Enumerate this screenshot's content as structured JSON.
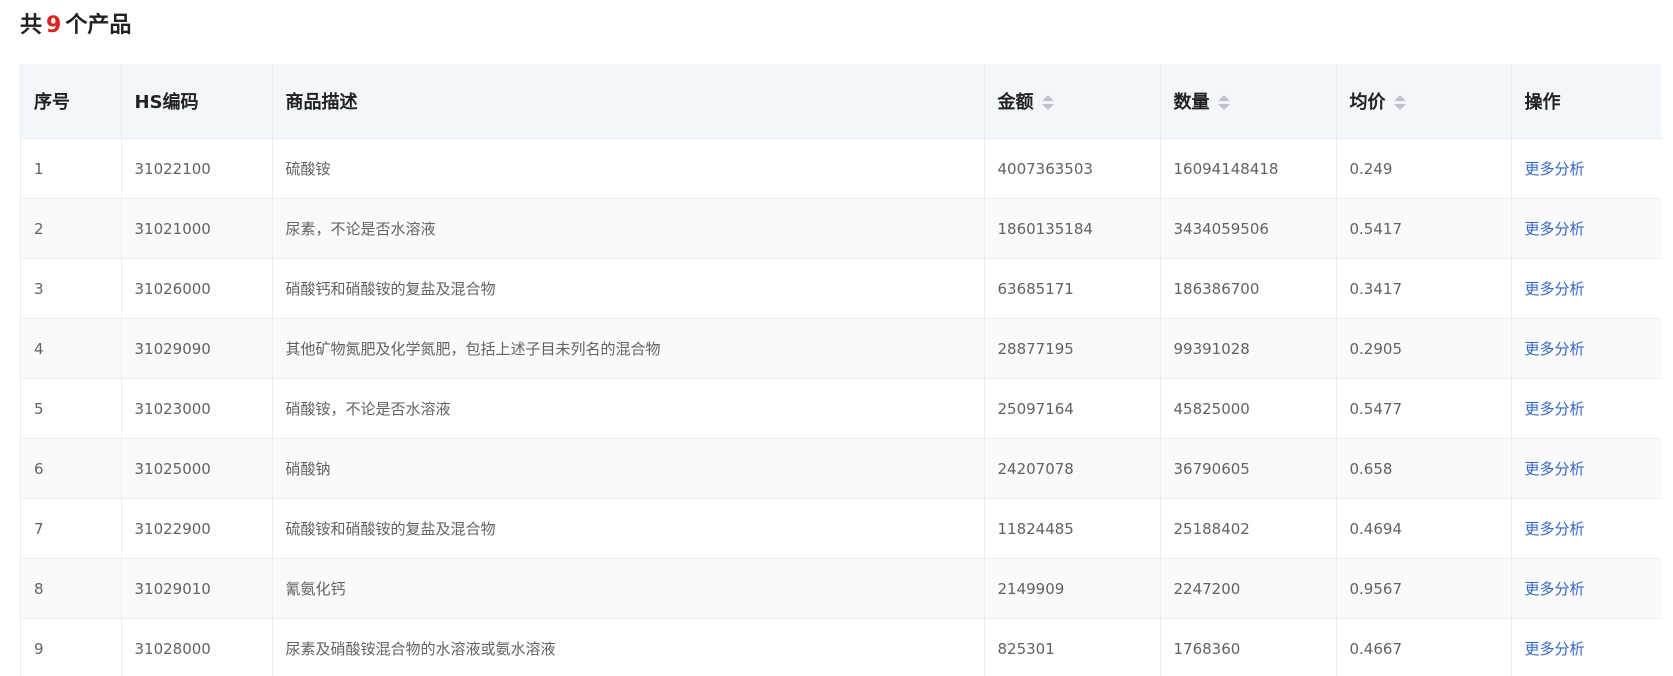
{
  "summary": {
    "prefix": "共",
    "count": "9",
    "suffix": "个产品"
  },
  "table": {
    "headers": {
      "index": "序号",
      "hs_code": "HS编码",
      "description": "商品描述",
      "amount": "金额",
      "quantity": "数量",
      "unit_price": "均价",
      "action": "操作"
    },
    "rows": [
      {
        "index": "1",
        "hs_code": "31022100",
        "description": "硫酸铵",
        "amount": "4007363503",
        "quantity": "16094148418",
        "unit_price": "0.249",
        "action": "更多分析"
      },
      {
        "index": "2",
        "hs_code": "31021000",
        "description": "尿素，不论是否水溶液",
        "amount": "1860135184",
        "quantity": "3434059506",
        "unit_price": "0.5417",
        "action": "更多分析"
      },
      {
        "index": "3",
        "hs_code": "31026000",
        "description": "硝酸钙和硝酸铵的复盐及混合物",
        "amount": "63685171",
        "quantity": "186386700",
        "unit_price": "0.3417",
        "action": "更多分析"
      },
      {
        "index": "4",
        "hs_code": "31029090",
        "description": "其他矿物氮肥及化学氮肥，包括上述子目未列名的混合物",
        "amount": "28877195",
        "quantity": "99391028",
        "unit_price": "0.2905",
        "action": "更多分析"
      },
      {
        "index": "5",
        "hs_code": "31023000",
        "description": "硝酸铵，不论是否水溶液",
        "amount": "25097164",
        "quantity": "45825000",
        "unit_price": "0.5477",
        "action": "更多分析"
      },
      {
        "index": "6",
        "hs_code": "31025000",
        "description": "硝酸钠",
        "amount": "24207078",
        "quantity": "36790605",
        "unit_price": "0.658",
        "action": "更多分析"
      },
      {
        "index": "7",
        "hs_code": "31022900",
        "description": "硫酸铵和硝酸铵的复盐及混合物",
        "amount": "11824485",
        "quantity": "25188402",
        "unit_price": "0.4694",
        "action": "更多分析"
      },
      {
        "index": "8",
        "hs_code": "31029010",
        "description": "氰氨化钙",
        "amount": "2149909",
        "quantity": "2247200",
        "unit_price": "0.9567",
        "action": "更多分析"
      },
      {
        "index": "9",
        "hs_code": "31028000",
        "description": "尿素及硝酸铵混合物的水溶液或氨水溶液",
        "amount": "825301",
        "quantity": "1768360",
        "unit_price": "0.4667",
        "action": "更多分析"
      }
    ]
  },
  "colors": {
    "count": "#e0201a",
    "link": "#3366cc",
    "header_bg": "#f3f7fb"
  }
}
